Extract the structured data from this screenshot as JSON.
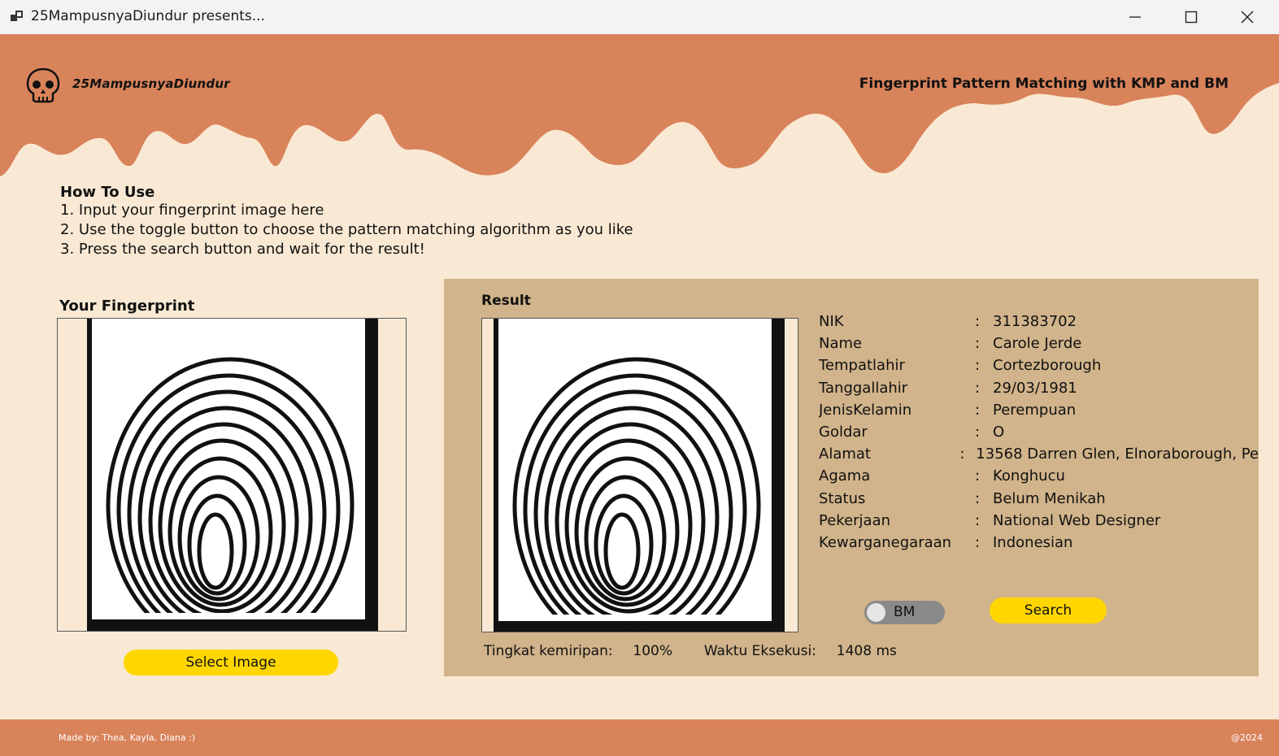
{
  "window": {
    "title": "25MampusnyaDiundur presents...",
    "icon": "app-window-icon",
    "controls": [
      "minimize-icon",
      "maximize-icon",
      "close-icon"
    ]
  },
  "header": {
    "brand": "25MampusnyaDiundur",
    "logo": "skull-icon",
    "heading": "Fingerprint Pattern Matching with KMP and BM"
  },
  "howto": {
    "title": "How To Use",
    "steps": [
      "1. Input your fingerprint image here",
      "2. Use the toggle button to choose the pattern matching algorithm as you like",
      "3. Press the search button and wait for the result!"
    ]
  },
  "input": {
    "label": "Your Fingerprint",
    "select_label": "Select Image"
  },
  "result": {
    "label": "Result",
    "fields": [
      {
        "key": "NIK",
        "value": "311383702"
      },
      {
        "key": "Name",
        "value": "Carole Jerde"
      },
      {
        "key": "Tempatlahir",
        "value": "Cortezborough"
      },
      {
        "key": "Tanggallahir",
        "value": "29/03/1981"
      },
      {
        "key": "JenisKelamin",
        "value": "Perempuan"
      },
      {
        "key": "Goldar",
        "value": "O"
      },
      {
        "key": "Alamat",
        "value": "13568 Darren Glen, Elnoraborough, Pe"
      },
      {
        "key": "Agama",
        "value": "Konghucu"
      },
      {
        "key": "Status",
        "value": "Belum Menikah"
      },
      {
        "key": "Pekerjaan",
        "value": "National Web Designer"
      },
      {
        "key": "Kewarganegaraan",
        "value": "Indonesian"
      }
    ],
    "colon": ":",
    "toggle_label": "BM",
    "search_label": "Search",
    "similarity_label": "Tingkat kemiripan:",
    "similarity_value": "100%",
    "time_label": "Waktu Eksekusi:",
    "time_value": "1408 ms"
  },
  "footer": {
    "credits": "Made by: Thea, Kayla, Diana :)",
    "year": "@2024"
  },
  "colors": {
    "header": "#d9835b",
    "background": "#f9e9d4",
    "panel": "#d1b48b",
    "button": "#ffd600",
    "toggle": "#8a8a8a"
  }
}
